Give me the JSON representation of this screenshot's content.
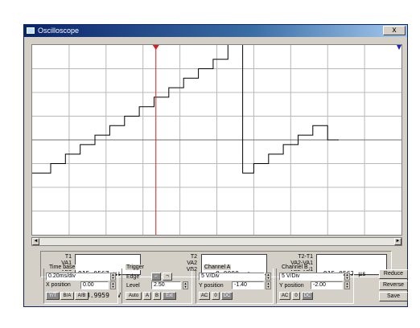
{
  "window": {
    "title": "Oscilloscope",
    "close_label": "x",
    "icon": "oscilloscope-window-icon"
  },
  "scope": {
    "grid_divisions_x": 10,
    "grid_divisions_y": 8,
    "trace_color": "#000000",
    "cursor1_color": "#d02020",
    "cursor2_color": "#2020d0"
  },
  "chart_data": {
    "type": "line",
    "series": [
      {
        "color": "#000000",
        "x": [
          0.0,
          0.5,
          0.5,
          0.9,
          0.9,
          1.3,
          1.3,
          1.7,
          1.7,
          2.1,
          2.1,
          2.5,
          2.5,
          2.9,
          2.9,
          3.3,
          3.3,
          3.7,
          3.7,
          4.1,
          4.1,
          4.5,
          4.5,
          4.9,
          4.9,
          5.3,
          5.3,
          5.7,
          5.7,
          6.0,
          6.0,
          6.4,
          6.4,
          6.8,
          6.8,
          7.2,
          7.2,
          7.6,
          7.6,
          8.0,
          8.0,
          8.3
        ],
        "y": [
          -1.4,
          -1.4,
          -1.0,
          -1.0,
          -0.6,
          -0.6,
          -0.2,
          -0.2,
          0.2,
          0.2,
          0.6,
          0.6,
          1.0,
          1.0,
          1.4,
          1.4,
          1.8,
          1.8,
          2.2,
          2.2,
          2.6,
          2.6,
          3.0,
          3.0,
          3.4,
          3.4,
          4.2,
          4.2,
          -1.4,
          -1.4,
          -1.0,
          -1.0,
          -0.6,
          -0.6,
          -0.2,
          -0.2,
          0.2,
          0.2,
          0.6,
          0.6,
          0.0,
          0.0
        ]
      }
    ],
    "x_unit": "div",
    "y_unit": "div",
    "xlim": [
      0,
      10
    ],
    "ylim": [
      -4,
      4
    ],
    "grid": true
  },
  "cursors": {
    "t1": {
      "label": "T1",
      "time": "915.0567 µs",
      "va_label": "VA1",
      "va": "8.9959  V",
      "vb_label": "VB1",
      "vb": ""
    },
    "t2": {
      "label": "T2",
      "time": "0.0000  s",
      "va_label": "VA2",
      "va": "",
      "vb_label": "VB2",
      "vb": ""
    },
    "diff": {
      "label": "T2-T1",
      "time": "-915.0567 µs",
      "va_label": "VA2-VA1",
      "va": "",
      "vb_label": "VB2-VB1",
      "vb": ""
    }
  },
  "timebase": {
    "title": "Time base",
    "value": "0.20ms/div",
    "xpos_label": "X position",
    "xpos": "0.00",
    "modes": [
      "Y/T",
      "B/A",
      "A/B"
    ]
  },
  "trigger": {
    "title": "Trigger",
    "edge_label": "Edge",
    "level_label": "Level",
    "level": "2.50",
    "modes": [
      "Auto",
      "A",
      "B",
      "Ext"
    ]
  },
  "channel_a": {
    "title": "Channel A",
    "value": "5 V/Div",
    "ypos_label": "Y position",
    "ypos": "-1.40",
    "coupling": [
      "AC",
      "0",
      "DC"
    ]
  },
  "channel_b": {
    "title": "Channel B",
    "value": "5 V/Div",
    "ypos_label": "Y position",
    "ypos": "-2.00",
    "coupling": [
      "AC",
      "0",
      "DC"
    ]
  },
  "actions": {
    "reduce": "Reduce",
    "reverse": "Reverse",
    "save": "Save"
  }
}
